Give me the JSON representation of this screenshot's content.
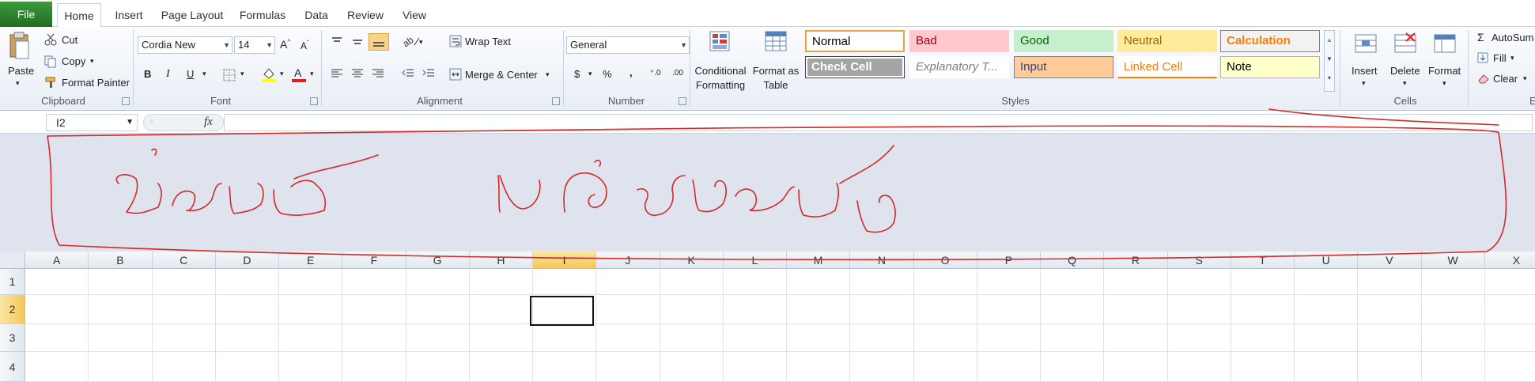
{
  "tabs": {
    "file": "File",
    "items": [
      "Home",
      "Insert",
      "Page Layout",
      "Formulas",
      "Data",
      "Review",
      "View"
    ],
    "active": "Home"
  },
  "clipboard": {
    "label": "Clipboard",
    "paste": "Paste",
    "cut": "Cut",
    "copy": "Copy",
    "format_painter": "Format Painter"
  },
  "font": {
    "label": "Font",
    "name": "Cordia New",
    "size": "14",
    "bold": "B",
    "italic": "I",
    "underline": "U",
    "font_color": "#e02020",
    "highlight_color": "#ffff00"
  },
  "alignment": {
    "label": "Alignment",
    "wrap_text": "Wrap Text",
    "merge_center": "Merge & Center"
  },
  "number": {
    "label": "Number",
    "format": "General",
    "currency": "$",
    "percent": "%",
    "comma": ","
  },
  "styles": {
    "label": "Styles",
    "conditional_formatting": [
      "Conditional",
      "Formatting"
    ],
    "format_as_table": [
      "Format as",
      "Table"
    ],
    "cells": [
      {
        "name": "Normal",
        "bg": "#ffffff",
        "fg": "#000000",
        "border": "#e6a545"
      },
      {
        "name": "Bad",
        "bg": "#ffc7ce",
        "fg": "#9c0006",
        "border": "#ffc7ce"
      },
      {
        "name": "Good",
        "bg": "#c6efce",
        "fg": "#006100",
        "border": "#c6efce"
      },
      {
        "name": "Neutral",
        "bg": "#ffeb9c",
        "fg": "#9c6500",
        "border": "#ffeb9c"
      },
      {
        "name": "Calculation",
        "bg": "#f2f2f2",
        "fg": "#fa7d00",
        "border": "#7f7f7f"
      },
      {
        "name": "Check Cell",
        "bg": "#a5a5a5",
        "fg": "#ffffff",
        "border": "#3f3f3f"
      },
      {
        "name": "Explanatory T...",
        "bg": "#ffffff",
        "fg": "#7f7f7f",
        "border": "#ffffff"
      },
      {
        "name": "Input",
        "bg": "#ffcc99",
        "fg": "#3f3f76",
        "border": "#7f7f7f"
      },
      {
        "name": "Linked Cell",
        "bg": "#ffffff",
        "fg": "#fa7d00",
        "border": "#ff8001"
      },
      {
        "name": "Note",
        "bg": "#ffffcc",
        "fg": "#000000",
        "border": "#b2b2b2"
      }
    ]
  },
  "cells_group": {
    "label": "Cells",
    "insert": "Insert",
    "delete": "Delete",
    "format": "Format"
  },
  "editing": {
    "autosum": "AutoSum",
    "fill": "Fill",
    "clear": "Clear",
    "label_cut": "E"
  },
  "formula_bar": {
    "name_box": "I2",
    "fx": "fx",
    "formula": ""
  },
  "grid": {
    "columns": [
      "A",
      "B",
      "C",
      "D",
      "E",
      "F",
      "G",
      "H",
      "I",
      "J",
      "K",
      "L",
      "M",
      "N",
      "O",
      "P",
      "Q",
      "R",
      "S",
      "T",
      "U",
      "V",
      "W",
      "X"
    ],
    "rows": [
      "1",
      "2",
      "3",
      "4"
    ],
    "selected_column": "I",
    "selected_row": "2"
  },
  "annotation": {
    "color": "#d42a2a",
    "handwriting": "ส่วนนี้ แก้อย่างไรครับ"
  }
}
